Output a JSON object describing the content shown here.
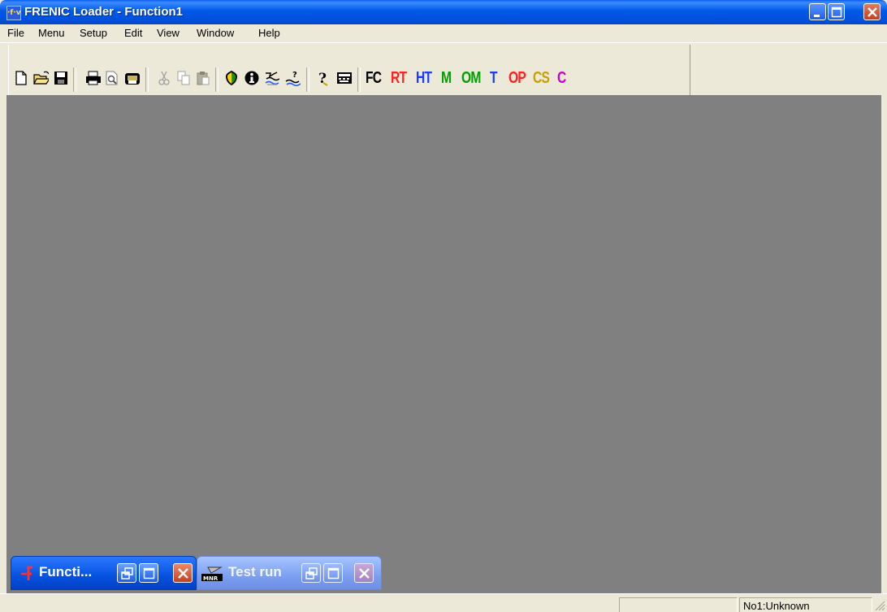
{
  "window": {
    "title": "FRENIC Loader - Function1",
    "app_icon_text": "·f·v"
  },
  "menu": [
    "File",
    "Menu",
    "Setup",
    "Edit",
    "View",
    "Window",
    "Help"
  ],
  "toolbar": {
    "buttons": [
      {
        "name": "new-icon"
      },
      {
        "name": "open-folder-icon"
      },
      {
        "name": "save-disk-icon"
      },
      {
        "name": "print-icon"
      },
      {
        "name": "print-preview-icon"
      },
      {
        "name": "printer-setup-icon"
      },
      {
        "name": "cut-icon"
      },
      {
        "name": "copy-icon"
      },
      {
        "name": "paste-icon"
      },
      {
        "name": "shield-icon"
      },
      {
        "name": "info-icon"
      },
      {
        "name": "connection-icon"
      },
      {
        "name": "help-connection-icon"
      },
      {
        "name": "help-icon"
      },
      {
        "name": "keyboard-icon"
      }
    ],
    "mode_buttons": [
      {
        "label": "FC",
        "color": "#000000"
      },
      {
        "label": "RT",
        "color": "#FF2020"
      },
      {
        "label": "HT",
        "color": "#1A3BFF"
      },
      {
        "label": "M",
        "color": "#00A000"
      },
      {
        "label": "OM",
        "color": "#00A000"
      },
      {
        "label": "T",
        "color": "#1A3BFF"
      },
      {
        "label": "OP",
        "color": "#FF2020"
      },
      {
        "label": "CS",
        "color": "#C8A000"
      },
      {
        "label": "C",
        "color": "#CC00CC"
      }
    ]
  },
  "mdi_children": [
    {
      "title": "Functi...",
      "active": true
    },
    {
      "title": "Test run",
      "active": false
    }
  ],
  "statusbar": {
    "pane1": "",
    "pane2": "No1:Unknown"
  },
  "colors": {
    "title_blue": "#0058E6",
    "face": "#ECE9D8",
    "client": "#808080"
  }
}
